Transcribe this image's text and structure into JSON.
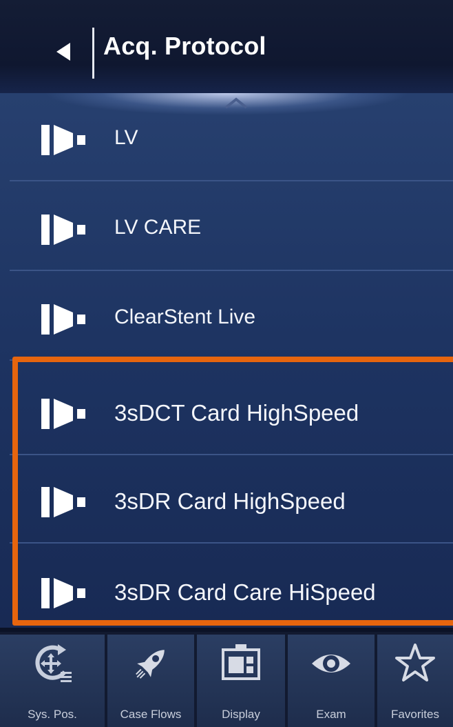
{
  "header": {
    "title": "Acq. Protocol",
    "back_icon": "back-arrow-icon"
  },
  "list": {
    "scroll_icon": "chevron-up-icon",
    "item_icon": "acquisition-protocol-icon",
    "items": [
      {
        "label": "LV"
      },
      {
        "label": "LV CARE"
      },
      {
        "label": "ClearStent Live"
      },
      {
        "label": "3sDCT Card HighSpeed"
      },
      {
        "label": "3sDR Card HighSpeed"
      },
      {
        "label": "3sDR Card Care HiSpeed"
      }
    ],
    "highlight_color": "#e6650e"
  },
  "toolbar": {
    "items": [
      {
        "label": "Sys. Pos.",
        "icon": "system-position-icon"
      },
      {
        "label": "Case Flows",
        "icon": "rocket-icon"
      },
      {
        "label": "Display",
        "icon": "display-layout-icon"
      },
      {
        "label": "Exam",
        "icon": "eye-icon"
      },
      {
        "label": "Favorites",
        "icon": "star-icon"
      }
    ]
  }
}
